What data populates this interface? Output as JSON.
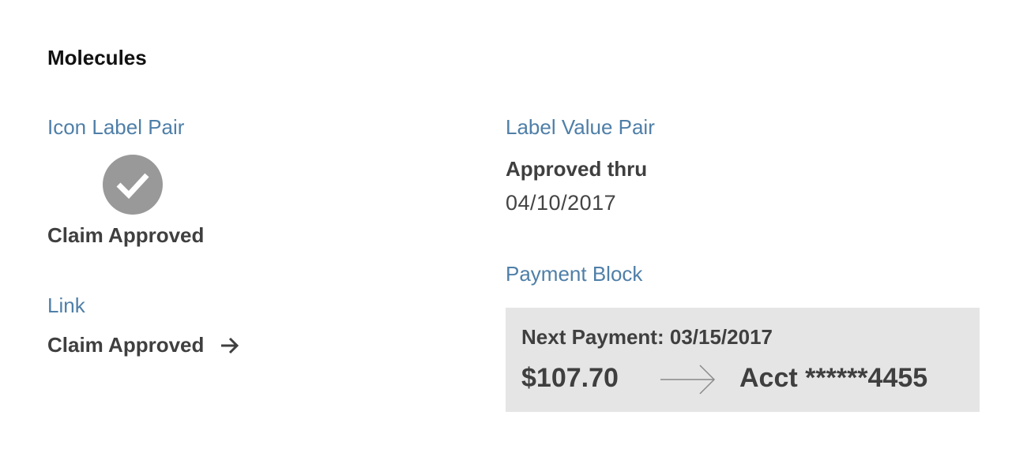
{
  "page": {
    "title": "Molecules"
  },
  "icon_label_pair": {
    "section_label": "Icon Label Pair",
    "icon": "check-icon",
    "label": "Claim Approved"
  },
  "link": {
    "section_label": "Link",
    "text": "Claim Approved",
    "icon": "arrow-right-icon"
  },
  "label_value_pair": {
    "section_label": "Label Value Pair",
    "label": "Approved thru",
    "value": "04/10/2017"
  },
  "payment_block": {
    "section_label": "Payment Block",
    "next_payment_label": "Next Payment:",
    "next_payment_date": "03/15/2017",
    "amount": "$107.70",
    "account": "Acct ******4455",
    "icon": "long-arrow-right-icon"
  },
  "colors": {
    "section_label": "#4f7fa8",
    "text_dark": "#3f3f3f",
    "icon_circle": "#999999",
    "payment_bg": "#e5e5e5"
  }
}
